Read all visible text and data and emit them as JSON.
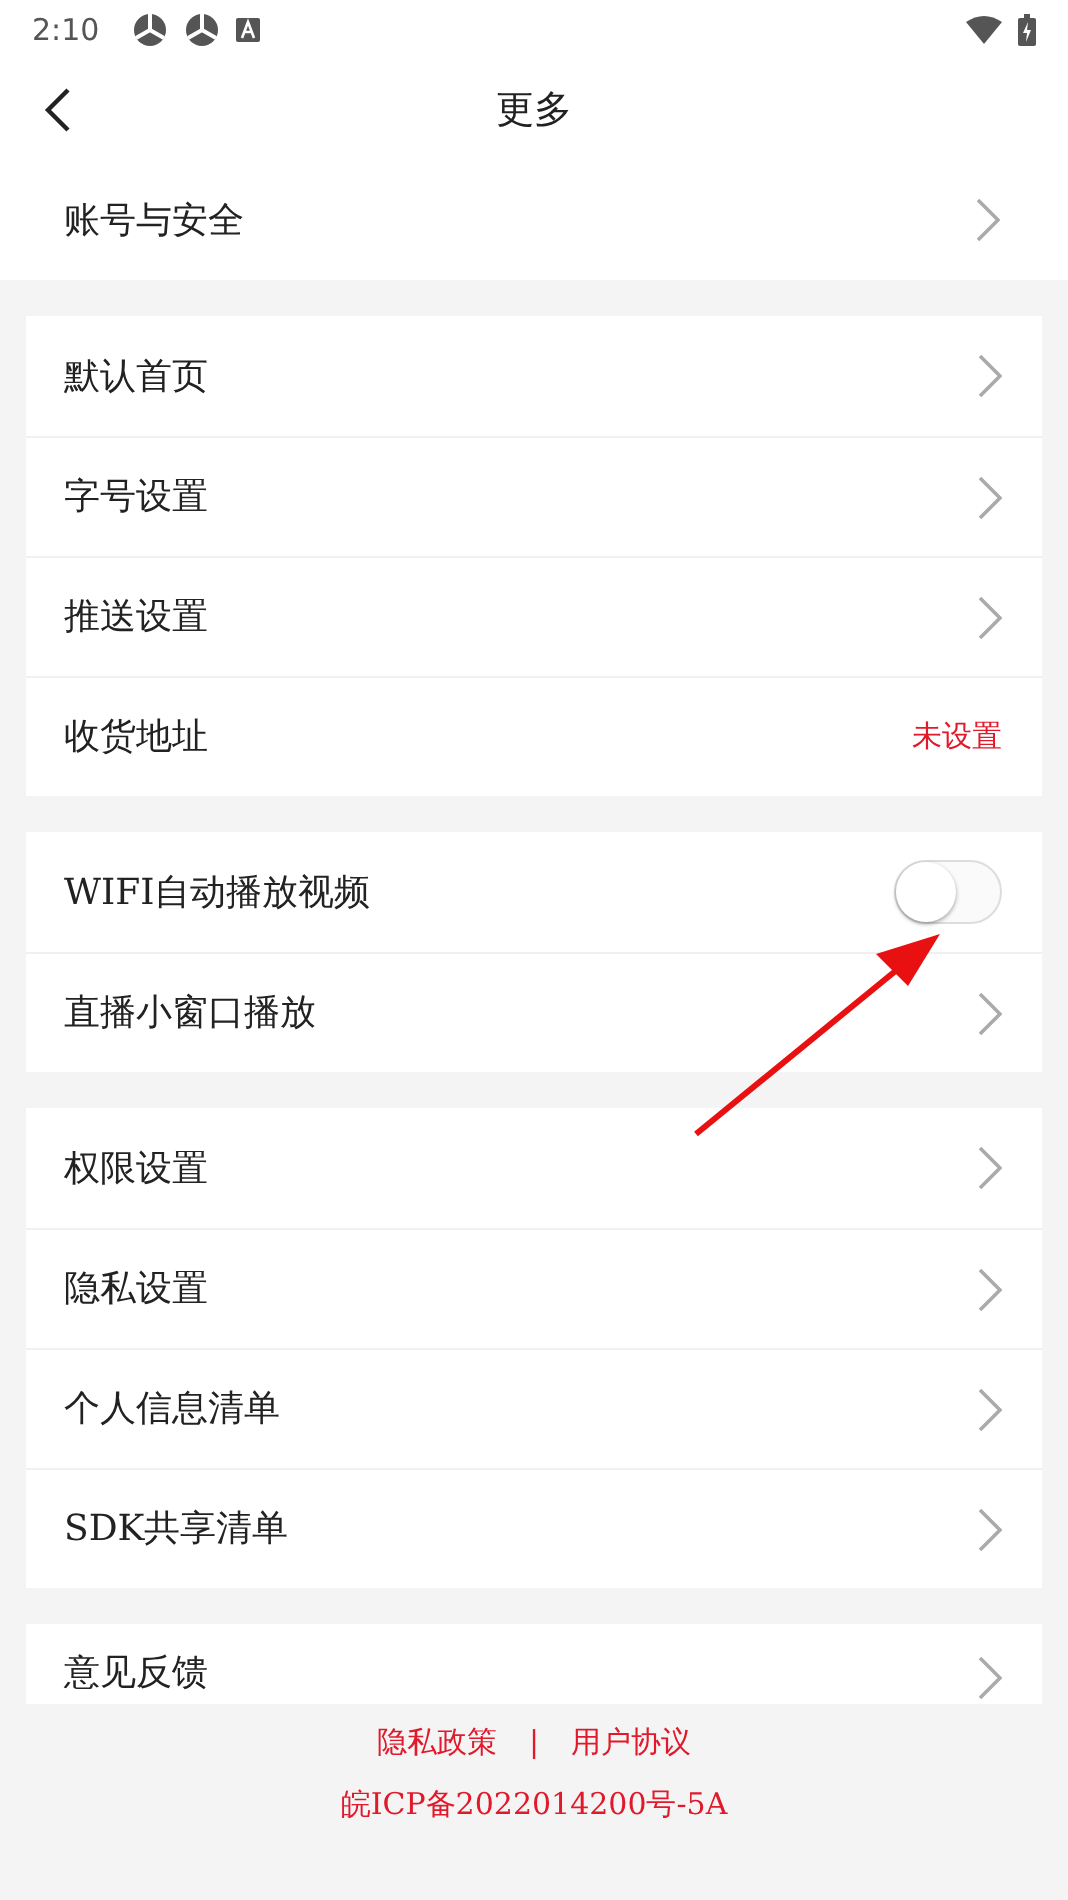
{
  "status_bar": {
    "time": "2:10"
  },
  "header": {
    "title": "更多"
  },
  "account_row": {
    "kind": "link",
    "label": "账号与安全"
  },
  "groups": [
    {
      "items": [
        {
          "kind": "link",
          "label": "默认首页"
        },
        {
          "kind": "link",
          "label": "字号设置"
        },
        {
          "kind": "link",
          "label": "推送设置"
        },
        {
          "kind": "value",
          "label": "收货地址",
          "value": "未设置"
        }
      ]
    },
    {
      "items": [
        {
          "kind": "toggle",
          "label": "WIFI自动播放视频",
          "on": false
        },
        {
          "kind": "link",
          "label": "直播小窗口播放"
        }
      ]
    },
    {
      "items": [
        {
          "kind": "link",
          "label": "权限设置"
        },
        {
          "kind": "link",
          "label": "隐私设置"
        },
        {
          "kind": "link",
          "label": "个人信息清单"
        },
        {
          "kind": "link",
          "label": "SDK共享清单"
        }
      ]
    },
    {
      "items": [
        {
          "kind": "link",
          "label": "意见反馈"
        }
      ]
    }
  ],
  "footer": {
    "links": [
      "隐私政策",
      "用户协议"
    ],
    "separator": "|",
    "icp": "皖ICP备2022014200号-5A"
  }
}
